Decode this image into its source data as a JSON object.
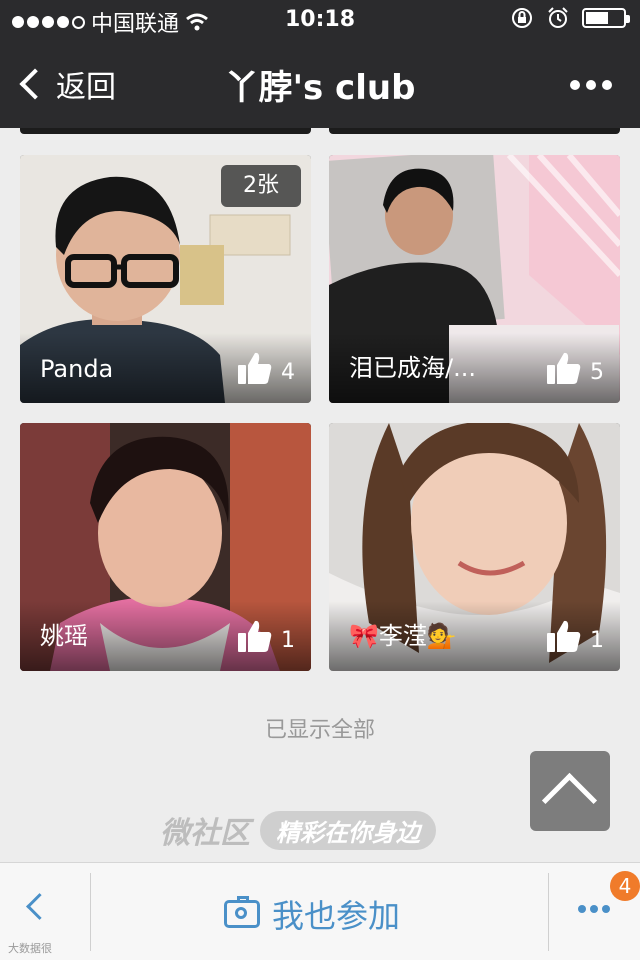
{
  "status_bar": {
    "carrier": "中国联通",
    "time": "10:18"
  },
  "nav": {
    "back_label": "返回",
    "title": "丫脖's club"
  },
  "cards": [
    {
      "name": "Panda",
      "likes": "4",
      "badge": "2张"
    },
    {
      "name": "泪已成海/...",
      "likes": "5"
    },
    {
      "name": "姚瑶",
      "likes": "1"
    },
    {
      "name": "🎀李滢💁",
      "likes": "1"
    }
  ],
  "list_footer": "已显示全部",
  "brand": {
    "main": "微社区",
    "tagline": "精彩在你身边"
  },
  "bottom_bar": {
    "join_label": "我也参加",
    "notification_count": "4"
  },
  "watermark": "大数据很",
  "colors": {
    "accent": "#4a90c8",
    "badge": "#f07b2a",
    "bar": "#2b2b2d"
  }
}
